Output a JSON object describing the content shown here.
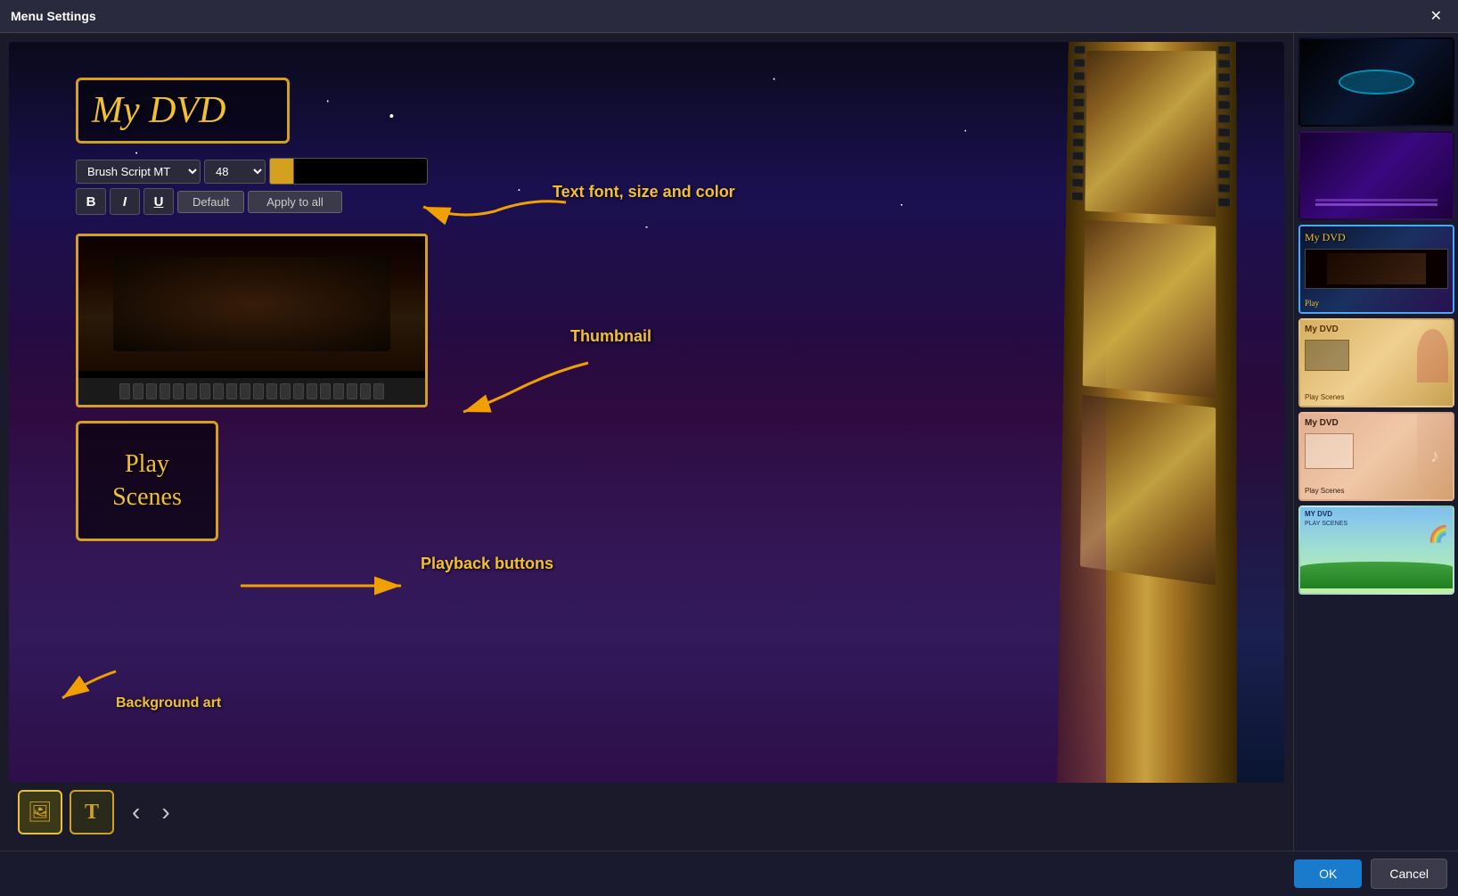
{
  "window": {
    "title": "Menu Settings",
    "close_label": "✕"
  },
  "preview": {
    "dvd_title": "My DVD",
    "font_name": "Brush Script MT",
    "font_size": "48",
    "bold_label": "B",
    "italic_label": "I",
    "underline_label": "U",
    "default_btn": "Default",
    "apply_all_btn": "Apply to all",
    "playback_text_line1": "Play",
    "playback_text_line2": "Scenes",
    "annotation_text_font": "Text font, size and color",
    "annotation_thumbnail": "Thumbnail",
    "annotation_playback": "Playback buttons",
    "annotation_background": "Background art"
  },
  "toolbar": {
    "image_tool_icon": "🖼",
    "text_tool_icon": "T",
    "prev_label": "‹",
    "next_label": "›"
  },
  "footer": {
    "ok_label": "OK",
    "cancel_label": "Cancel"
  },
  "thumbnails": [
    {
      "id": 1,
      "bg_class": "thumb-bg-1",
      "label": ""
    },
    {
      "id": 2,
      "bg_class": "thumb-bg-2",
      "label": ""
    },
    {
      "id": 3,
      "bg_class": "thumb-bg-3",
      "label": "My DVD",
      "active": true
    },
    {
      "id": 4,
      "bg_class": "thumb-bg-4",
      "label": "My DVD"
    },
    {
      "id": 5,
      "bg_class": "thumb-bg-5",
      "label": "My DVD"
    },
    {
      "id": 6,
      "bg_class": "thumb-bg-6",
      "label": "MY DVD"
    }
  ]
}
